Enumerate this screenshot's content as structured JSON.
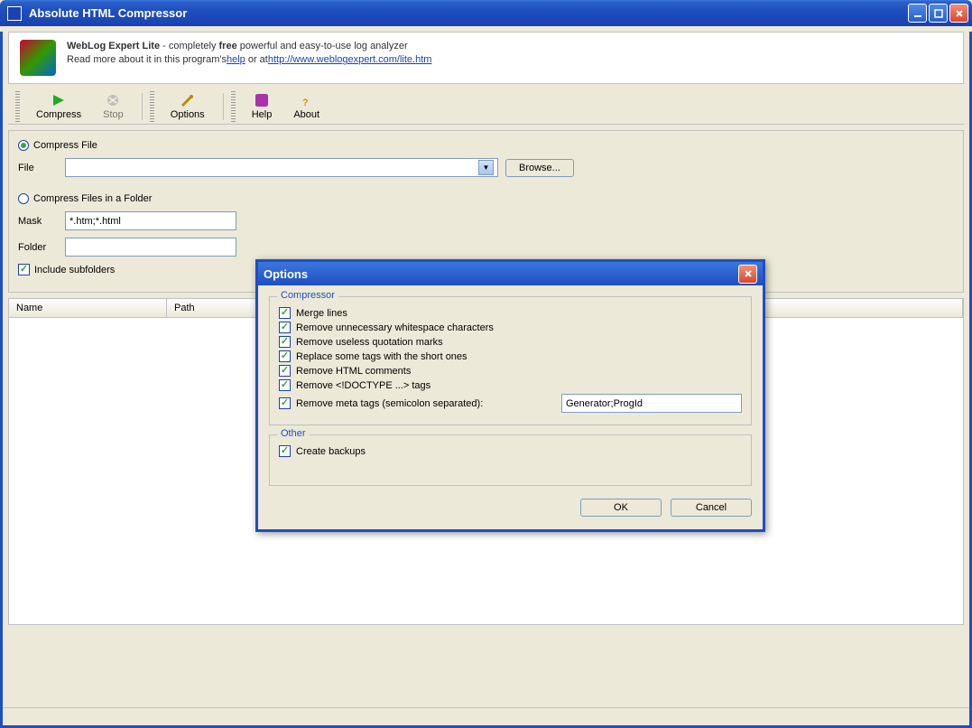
{
  "window": {
    "title": "Absolute HTML Compressor"
  },
  "banner": {
    "productName": "WebLog Expert Lite",
    "tagline1": " - completely ",
    "tagline1b": "free",
    "tagline2": "   powerful and easy-to-use log analyzer",
    "line2a": "Read more about it in this program's",
    "helpLink": "help",
    "line2b": " or at",
    "url": "http://www.weblogexpert.com/lite.htm"
  },
  "toolbar": {
    "compress": "Compress",
    "stop": "Stop",
    "options": "Options",
    "help": "Help",
    "about": "About"
  },
  "main": {
    "compressFile": "Compress File",
    "fileLabel": "File",
    "browse": "Browse...",
    "compressFolder": "Compress Files in a Folder",
    "maskLabel": "Mask",
    "maskValue": "*.htm;*.html",
    "folderLabel": "Folder",
    "includeSub": "Include subfolders",
    "colName": "Name",
    "colPath": "Path"
  },
  "dialog": {
    "title": "Options",
    "compressorLegend": "Compressor",
    "opts": [
      "Merge lines",
      "Remove unnecessary whitespace characters",
      "Remove useless quotation marks",
      "Replace some tags with the short ones",
      "Remove HTML comments",
      "Remove <!DOCTYPE ...> tags",
      "Remove meta tags (semicolon separated):"
    ],
    "metaValue": "Generator;ProgId",
    "otherLegend": "Other",
    "createBackups": "Create backups",
    "ok": "OK",
    "cancel": "Cancel"
  }
}
